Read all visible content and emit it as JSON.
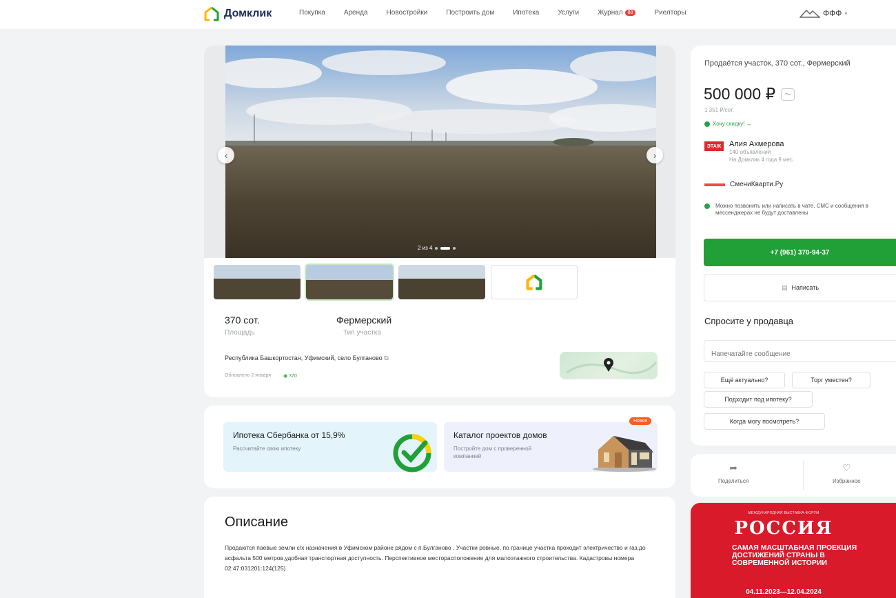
{
  "header": {
    "logo_text": "Домклик",
    "nav": [
      "Покупка",
      "Аренда",
      "Новостройки",
      "Построить дом",
      "Ипотека",
      "Услуги",
      "Журнал",
      "Риелторы"
    ],
    "journal_badge": "88",
    "right_text": "ФФФ"
  },
  "gallery": {
    "counter": "2 из 4"
  },
  "listing": {
    "area_value": "370 сот.",
    "area_label": "Площадь",
    "type_value": "Фермерский",
    "type_label": "Тип участка",
    "address": "Республика Башкортостан, Уфимский, село Булганово",
    "updated": "Обновлено 2 января",
    "views": "370"
  },
  "promo": {
    "mortgage_title": "Ипотека Сбербанка от 15,9%",
    "mortgage_sub": "Рассчитайте свою ипотеку",
    "catalog_title": "Каталог проектов домов",
    "catalog_sub": "Постройте дом с проверенной компанией",
    "new_badge": "Новое"
  },
  "description": {
    "title": "Описание",
    "text": "Продаются паевые земли с/х назначения в Уфимском районе рядом с п.Булганово . Участки ровные, по границе участка проходит электричество и газ,до асфальта 500 метров,удобная транспортная доступность. Перспективное месторасположение для малоэтажного строительства. Кадастровы номера 02:47:031201:124(125)"
  },
  "side": {
    "title": "Продаётся участок, 370 сот., Фермерский",
    "price": "500 000 ₽",
    "per_unit": "1 351 ₽/сот.",
    "discount": "Хочу скидку! →",
    "agent_logo": "ЭТАЖ",
    "agent_name": "Алия Ахмерова",
    "agent_ads": "140 объявлений",
    "agent_since": "На Домклик 4 года 9 мес.",
    "agency": "СмениКварти.Ру",
    "notice": "Можно позвонить или написать в чате, СМС и сообщения в мессенджерах не будут доставлены",
    "phone": "+7 (961) 370-94-37",
    "write": "Написать",
    "ask_title": "Спросите у продавца",
    "input_placeholder": "Напечатайте сообщение",
    "chips": [
      "Ещё актуально?",
      "Торг уместен?",
      "Подходит под ипотеку?",
      "Когда могу посмотреть?"
    ],
    "share": "Поделиться",
    "favorite": "Избранное"
  },
  "banner": {
    "top": "МЕЖДУНАРОДНАЯ ВЫСТАВКА-ФОРУМ",
    "big": "РОССИЯ",
    "text": "САМАЯ МАСШТАБНАЯ ПРОЕКЦИЯ ДОСТИЖЕНИЙ СТРАНЫ В СОВРЕМЕННОЙ ИСТОРИИ",
    "dates": "04.11.2023—12.04.2024"
  },
  "colors": {
    "accent_green": "#21a038",
    "brand_red": "#d91a2a",
    "badge_orange": "#ff5c1f"
  }
}
